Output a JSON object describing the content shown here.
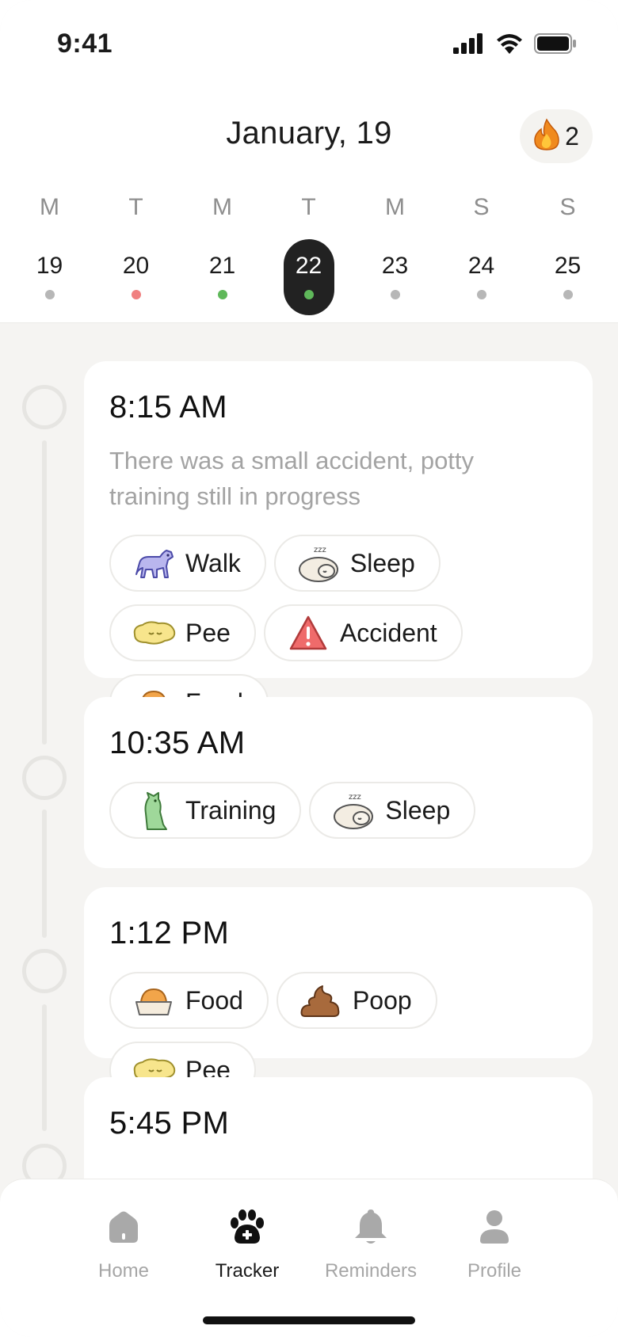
{
  "status_bar": {
    "time": "9:41"
  },
  "header": {
    "title": "January, 19",
    "streak": {
      "icon": "flame-icon",
      "count": "2"
    }
  },
  "week": [
    {
      "letter": "M",
      "number": "19",
      "dot_color": "#b7b7b7",
      "active": false
    },
    {
      "letter": "T",
      "number": "20",
      "dot_color": "#f08080",
      "active": false
    },
    {
      "letter": "M",
      "number": "21",
      "dot_color": "#5fb85a",
      "active": false
    },
    {
      "letter": "T",
      "number": "22",
      "dot_color": "#5fb85a",
      "active": true
    },
    {
      "letter": "M",
      "number": "23",
      "dot_color": "#b7b7b7",
      "active": false
    },
    {
      "letter": "S",
      "number": "24",
      "dot_color": "#b7b7b7",
      "active": false
    },
    {
      "letter": "S",
      "number": "25",
      "dot_color": "#b7b7b7",
      "active": false
    }
  ],
  "entries": [
    {
      "time": "8:15 AM",
      "note": "There was a small accident, potty training still in progress",
      "tags": [
        {
          "label": "Walk",
          "icon": "dog-walk-icon"
        },
        {
          "label": "Sleep",
          "icon": "sleeping-dog-icon"
        },
        {
          "label": "Pee",
          "icon": "pee-puddle-icon"
        },
        {
          "label": "Accident",
          "icon": "warning-icon"
        },
        {
          "label": "Food",
          "icon": "food-bowl-icon"
        }
      ]
    },
    {
      "time": "10:35 AM",
      "note": "",
      "tags": [
        {
          "label": "Training",
          "icon": "sitting-dog-icon"
        },
        {
          "label": "Sleep",
          "icon": "sleeping-dog-icon"
        }
      ]
    },
    {
      "time": "1:12 PM",
      "note": "",
      "tags": [
        {
          "label": "Food",
          "icon": "food-bowl-icon"
        },
        {
          "label": "Poop",
          "icon": "poop-icon"
        },
        {
          "label": "Pee",
          "icon": "pee-puddle-icon"
        }
      ]
    },
    {
      "time": "5:45 PM",
      "note": "",
      "tags": []
    }
  ],
  "nav": [
    {
      "label": "Home",
      "icon": "home-icon",
      "active": false
    },
    {
      "label": "Tracker",
      "icon": "paw-plus-icon",
      "active": true
    },
    {
      "label": "Reminders",
      "icon": "bell-icon",
      "active": false
    },
    {
      "label": "Profile",
      "icon": "person-icon",
      "active": false
    }
  ],
  "colors": {
    "active_day_bg": "#222222",
    "background": "#f5f4f2",
    "muted_text": "#a3a3a3"
  }
}
